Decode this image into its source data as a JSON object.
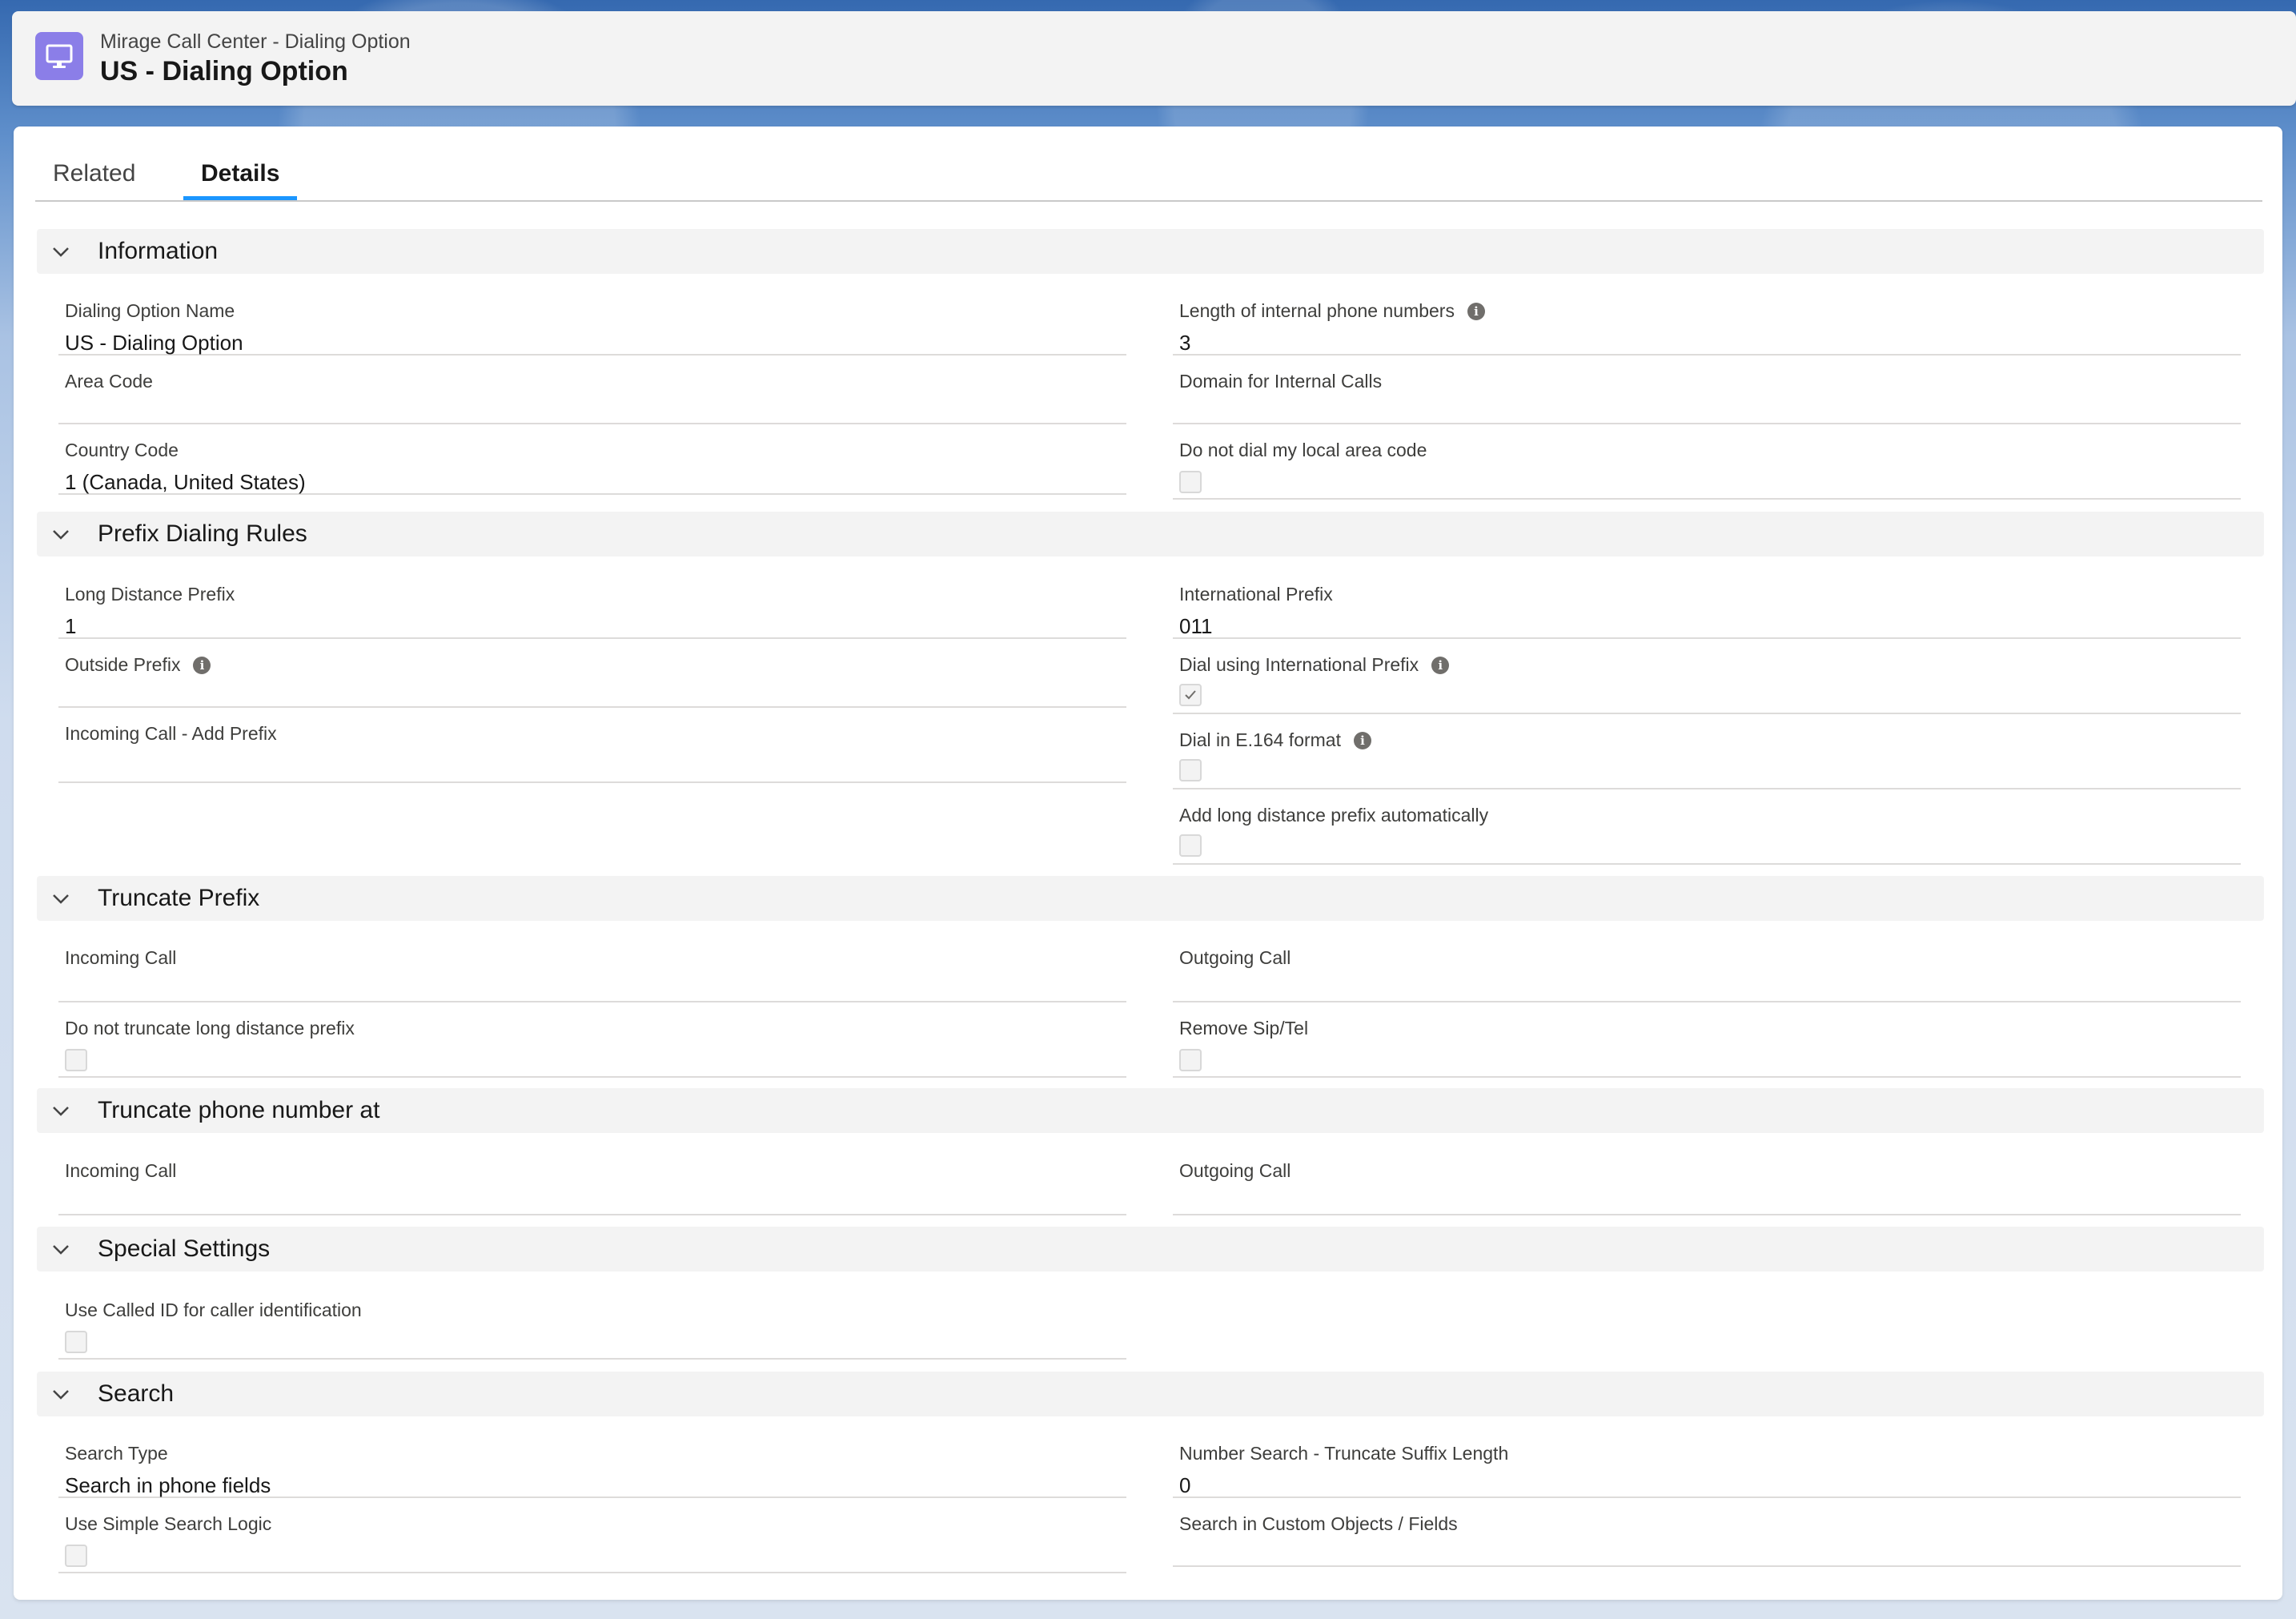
{
  "header": {
    "object_type": "Mirage Call Center - Dialing Option",
    "record_title": "US - Dialing Option"
  },
  "tabs": [
    {
      "label": "Related",
      "active": false
    },
    {
      "label": "Details",
      "active": true
    }
  ],
  "sections": {
    "information": {
      "title": "Information",
      "dialing_option_name": {
        "label": "Dialing Option Name",
        "value": "US - Dialing Option"
      },
      "length_internal": {
        "label": "Length of internal phone numbers",
        "value": "3"
      },
      "area_code": {
        "label": "Area Code",
        "value": ""
      },
      "domain_internal": {
        "label": "Domain for Internal Calls",
        "value": ""
      },
      "country_code": {
        "label": "Country Code",
        "value": "1 (Canada, United States)"
      },
      "do_not_dial_local": {
        "label": "Do not dial my local area code",
        "checked": false
      }
    },
    "prefix": {
      "title": "Prefix Dialing Rules",
      "long_distance_prefix": {
        "label": "Long Distance Prefix",
        "value": "1"
      },
      "international_prefix": {
        "label": "International Prefix",
        "value": "011"
      },
      "outside_prefix": {
        "label": "Outside Prefix",
        "value": ""
      },
      "dial_using_international": {
        "label": "Dial using International Prefix",
        "checked": true
      },
      "incoming_add_prefix": {
        "label": "Incoming Call - Add Prefix",
        "value": ""
      },
      "dial_e164": {
        "label": "Dial in E.164 format",
        "checked": false
      },
      "add_long_distance_auto": {
        "label": "Add long distance prefix automatically",
        "checked": false
      }
    },
    "truncate_prefix": {
      "title": "Truncate Prefix",
      "incoming_call": {
        "label": "Incoming Call",
        "value": ""
      },
      "outgoing_call": {
        "label": "Outgoing Call",
        "value": ""
      },
      "do_not_truncate": {
        "label": "Do not truncate long distance prefix",
        "checked": false
      },
      "remove_sip_tel": {
        "label": "Remove Sip/Tel",
        "checked": false
      }
    },
    "truncate_number": {
      "title": "Truncate phone number at",
      "incoming_call": {
        "label": "Incoming Call",
        "value": ""
      },
      "outgoing_call": {
        "label": "Outgoing Call",
        "value": ""
      }
    },
    "special": {
      "title": "Special Settings",
      "use_called_id": {
        "label": "Use Called ID for caller identification",
        "checked": false
      }
    },
    "search": {
      "title": "Search",
      "search_type": {
        "label": "Search Type",
        "value": "Search in phone fields"
      },
      "truncate_suffix": {
        "label": "Number Search - Truncate Suffix Length",
        "value": "0"
      },
      "simple_search": {
        "label": "Use Simple Search Logic",
        "checked": false
      },
      "custom_objects": {
        "label": "Search in Custom Objects / Fields",
        "value": ""
      }
    }
  },
  "icons": {
    "object_icon": "desktop-monitor-icon",
    "section_toggle": "chevron-down-icon",
    "help": "info-icon",
    "checkmark": "check-icon"
  },
  "colors": {
    "object_icon_bg": "#8b7ee8",
    "active_tab_underline": "#1b96ff",
    "section_header_bg": "#f3f3f3"
  }
}
